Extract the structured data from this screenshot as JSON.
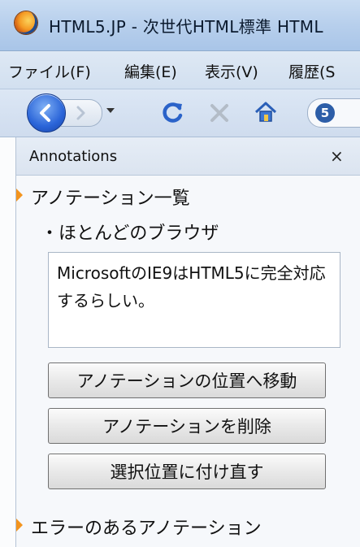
{
  "window": {
    "title": "HTML5.JP - 次世代HTML標準 HTML"
  },
  "menubar": {
    "items": [
      {
        "label": "ファイル(F)"
      },
      {
        "label": "編集(E)"
      },
      {
        "label": "表示(V)"
      },
      {
        "label": "履歴(S"
      }
    ]
  },
  "navbar": {
    "site_icon_glyph": "5"
  },
  "sidebar": {
    "title": "Annotations",
    "close_label": "×",
    "tree": {
      "group_label": "アノテーション一覧",
      "item_label": "・ほとんどのブラウザ",
      "note_text": "MicrosoftのIE9はHTML5に完全対応するらしい。",
      "error_group_label": "エラーのあるアノテーション"
    },
    "buttons": {
      "goto_label": "アノテーションの位置へ移動",
      "delete_label": "アノテーションを削除",
      "reattach_label": "選択位置に付け直す"
    }
  },
  "colors": {
    "accent_twisty": "#f3941e",
    "chrome_blue": "#b7cfec",
    "back_button_blue": "#2a64d8"
  }
}
